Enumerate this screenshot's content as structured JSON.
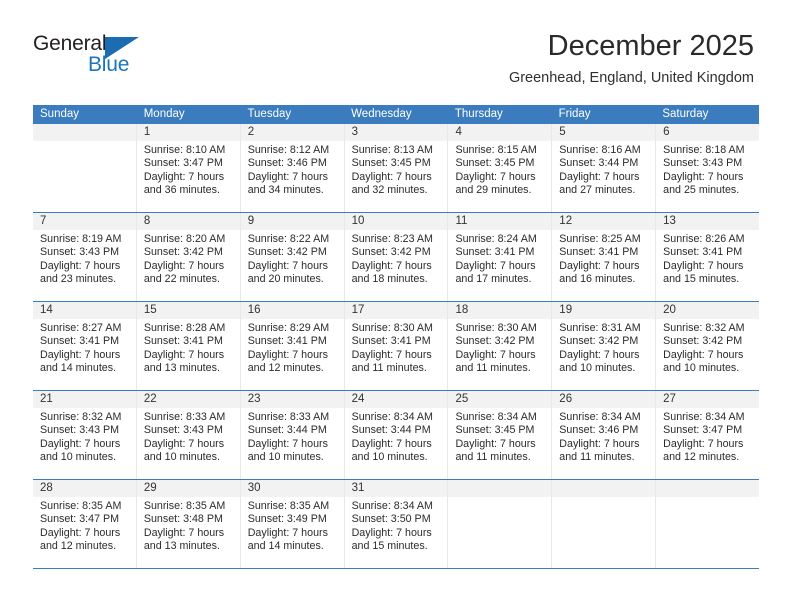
{
  "brand": {
    "name_top": "General",
    "name_bottom": "Blue",
    "accent_color": "#1b75bb",
    "header_color": "#3a7cbe"
  },
  "header": {
    "title": "December 2025",
    "subtitle": "Greenhead, England, United Kingdom"
  },
  "weekdays": [
    "Sunday",
    "Monday",
    "Tuesday",
    "Wednesday",
    "Thursday",
    "Friday",
    "Saturday"
  ],
  "weeks": [
    [
      {
        "day": "",
        "lines": [
          "",
          "",
          "",
          ""
        ]
      },
      {
        "day": "1",
        "lines": [
          "Sunrise: 8:10 AM",
          "Sunset: 3:47 PM",
          "Daylight: 7 hours",
          "and 36 minutes."
        ]
      },
      {
        "day": "2",
        "lines": [
          "Sunrise: 8:12 AM",
          "Sunset: 3:46 PM",
          "Daylight: 7 hours",
          "and 34 minutes."
        ]
      },
      {
        "day": "3",
        "lines": [
          "Sunrise: 8:13 AM",
          "Sunset: 3:45 PM",
          "Daylight: 7 hours",
          "and 32 minutes."
        ]
      },
      {
        "day": "4",
        "lines": [
          "Sunrise: 8:15 AM",
          "Sunset: 3:45 PM",
          "Daylight: 7 hours",
          "and 29 minutes."
        ]
      },
      {
        "day": "5",
        "lines": [
          "Sunrise: 8:16 AM",
          "Sunset: 3:44 PM",
          "Daylight: 7 hours",
          "and 27 minutes."
        ]
      },
      {
        "day": "6",
        "lines": [
          "Sunrise: 8:18 AM",
          "Sunset: 3:43 PM",
          "Daylight: 7 hours",
          "and 25 minutes."
        ]
      }
    ],
    [
      {
        "day": "7",
        "lines": [
          "Sunrise: 8:19 AM",
          "Sunset: 3:43 PM",
          "Daylight: 7 hours",
          "and 23 minutes."
        ]
      },
      {
        "day": "8",
        "lines": [
          "Sunrise: 8:20 AM",
          "Sunset: 3:42 PM",
          "Daylight: 7 hours",
          "and 22 minutes."
        ]
      },
      {
        "day": "9",
        "lines": [
          "Sunrise: 8:22 AM",
          "Sunset: 3:42 PM",
          "Daylight: 7 hours",
          "and 20 minutes."
        ]
      },
      {
        "day": "10",
        "lines": [
          "Sunrise: 8:23 AM",
          "Sunset: 3:42 PM",
          "Daylight: 7 hours",
          "and 18 minutes."
        ]
      },
      {
        "day": "11",
        "lines": [
          "Sunrise: 8:24 AM",
          "Sunset: 3:41 PM",
          "Daylight: 7 hours",
          "and 17 minutes."
        ]
      },
      {
        "day": "12",
        "lines": [
          "Sunrise: 8:25 AM",
          "Sunset: 3:41 PM",
          "Daylight: 7 hours",
          "and 16 minutes."
        ]
      },
      {
        "day": "13",
        "lines": [
          "Sunrise: 8:26 AM",
          "Sunset: 3:41 PM",
          "Daylight: 7 hours",
          "and 15 minutes."
        ]
      }
    ],
    [
      {
        "day": "14",
        "lines": [
          "Sunrise: 8:27 AM",
          "Sunset: 3:41 PM",
          "Daylight: 7 hours",
          "and 14 minutes."
        ]
      },
      {
        "day": "15",
        "lines": [
          "Sunrise: 8:28 AM",
          "Sunset: 3:41 PM",
          "Daylight: 7 hours",
          "and 13 minutes."
        ]
      },
      {
        "day": "16",
        "lines": [
          "Sunrise: 8:29 AM",
          "Sunset: 3:41 PM",
          "Daylight: 7 hours",
          "and 12 minutes."
        ]
      },
      {
        "day": "17",
        "lines": [
          "Sunrise: 8:30 AM",
          "Sunset: 3:41 PM",
          "Daylight: 7 hours",
          "and 11 minutes."
        ]
      },
      {
        "day": "18",
        "lines": [
          "Sunrise: 8:30 AM",
          "Sunset: 3:42 PM",
          "Daylight: 7 hours",
          "and 11 minutes."
        ]
      },
      {
        "day": "19",
        "lines": [
          "Sunrise: 8:31 AM",
          "Sunset: 3:42 PM",
          "Daylight: 7 hours",
          "and 10 minutes."
        ]
      },
      {
        "day": "20",
        "lines": [
          "Sunrise: 8:32 AM",
          "Sunset: 3:42 PM",
          "Daylight: 7 hours",
          "and 10 minutes."
        ]
      }
    ],
    [
      {
        "day": "21",
        "lines": [
          "Sunrise: 8:32 AM",
          "Sunset: 3:43 PM",
          "Daylight: 7 hours",
          "and 10 minutes."
        ]
      },
      {
        "day": "22",
        "lines": [
          "Sunrise: 8:33 AM",
          "Sunset: 3:43 PM",
          "Daylight: 7 hours",
          "and 10 minutes."
        ]
      },
      {
        "day": "23",
        "lines": [
          "Sunrise: 8:33 AM",
          "Sunset: 3:44 PM",
          "Daylight: 7 hours",
          "and 10 minutes."
        ]
      },
      {
        "day": "24",
        "lines": [
          "Sunrise: 8:34 AM",
          "Sunset: 3:44 PM",
          "Daylight: 7 hours",
          "and 10 minutes."
        ]
      },
      {
        "day": "25",
        "lines": [
          "Sunrise: 8:34 AM",
          "Sunset: 3:45 PM",
          "Daylight: 7 hours",
          "and 11 minutes."
        ]
      },
      {
        "day": "26",
        "lines": [
          "Sunrise: 8:34 AM",
          "Sunset: 3:46 PM",
          "Daylight: 7 hours",
          "and 11 minutes."
        ]
      },
      {
        "day": "27",
        "lines": [
          "Sunrise: 8:34 AM",
          "Sunset: 3:47 PM",
          "Daylight: 7 hours",
          "and 12 minutes."
        ]
      }
    ],
    [
      {
        "day": "28",
        "lines": [
          "Sunrise: 8:35 AM",
          "Sunset: 3:47 PM",
          "Daylight: 7 hours",
          "and 12 minutes."
        ]
      },
      {
        "day": "29",
        "lines": [
          "Sunrise: 8:35 AM",
          "Sunset: 3:48 PM",
          "Daylight: 7 hours",
          "and 13 minutes."
        ]
      },
      {
        "day": "30",
        "lines": [
          "Sunrise: 8:35 AM",
          "Sunset: 3:49 PM",
          "Daylight: 7 hours",
          "and 14 minutes."
        ]
      },
      {
        "day": "31",
        "lines": [
          "Sunrise: 8:34 AM",
          "Sunset: 3:50 PM",
          "Daylight: 7 hours",
          "and 15 minutes."
        ]
      },
      {
        "day": "",
        "lines": [
          "",
          "",
          "",
          ""
        ]
      },
      {
        "day": "",
        "lines": [
          "",
          "",
          "",
          ""
        ]
      },
      {
        "day": "",
        "lines": [
          "",
          "",
          "",
          ""
        ]
      }
    ]
  ]
}
